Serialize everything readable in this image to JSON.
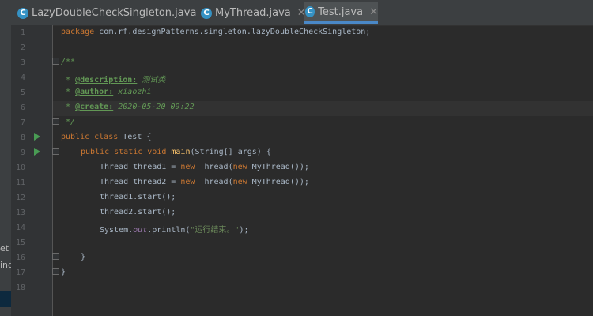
{
  "tabs": [
    {
      "label": "LazyDoubleCheckSingleton.java",
      "icon": "java-class-icon"
    },
    {
      "label": "MyThread.java",
      "icon": "java-class-icon"
    },
    {
      "label": "Test.java",
      "icon": "java-class-icon",
      "active": true
    }
  ],
  "left_panel_fragments": [
    "et",
    "ing"
  ],
  "line_numbers": [
    "1",
    "2",
    "3",
    "4",
    "5",
    "6",
    "7",
    "8",
    "9",
    "10",
    "11",
    "12",
    "13",
    "14",
    "15",
    "16",
    "17",
    "18"
  ],
  "code": {
    "l1_kw": "package",
    "l1_rest": " com.rf.designPatterns.singleton.lazyDoubleCheckSingleton;",
    "l3": "/**",
    "l4_star": " * ",
    "l4_tag": "@description:",
    "l4_val": " 测试类",
    "l5_star": " * ",
    "l5_tag": "@author:",
    "l5_val": " xiaozhi",
    "l6_star": " * ",
    "l6_tag": "@create:",
    "l6_val": " 2020-05-20 09:22",
    "l7": " */",
    "l8_kw": "public class",
    "l8_rest": " Test {",
    "l9_kw": "public static void",
    "l9_fn": " main",
    "l9_rest": "(String[] args) {",
    "l10_a": "Thread thread1 = ",
    "l10_kw1": "new",
    "l10_b": " Thread(",
    "l10_kw2": "new",
    "l10_c": " MyThread());",
    "l11_a": "Thread thread2 = ",
    "l11_kw1": "new",
    "l11_b": " Thread(",
    "l11_kw2": "new",
    "l11_c": " MyThread());",
    "l12": "thread1.start();",
    "l13": "thread2.start();",
    "l14_a": "System.",
    "l14_st": "out",
    "l14_b": ".println(",
    "l14_str": "\"运行结束。\"",
    "l14_c": ");",
    "l16": "}",
    "l17": "}"
  },
  "colors": {
    "background": "#2b2b2b",
    "keyword": "#cc7832",
    "comment": "#629755",
    "string": "#6a8759",
    "method": "#ffc66d"
  }
}
